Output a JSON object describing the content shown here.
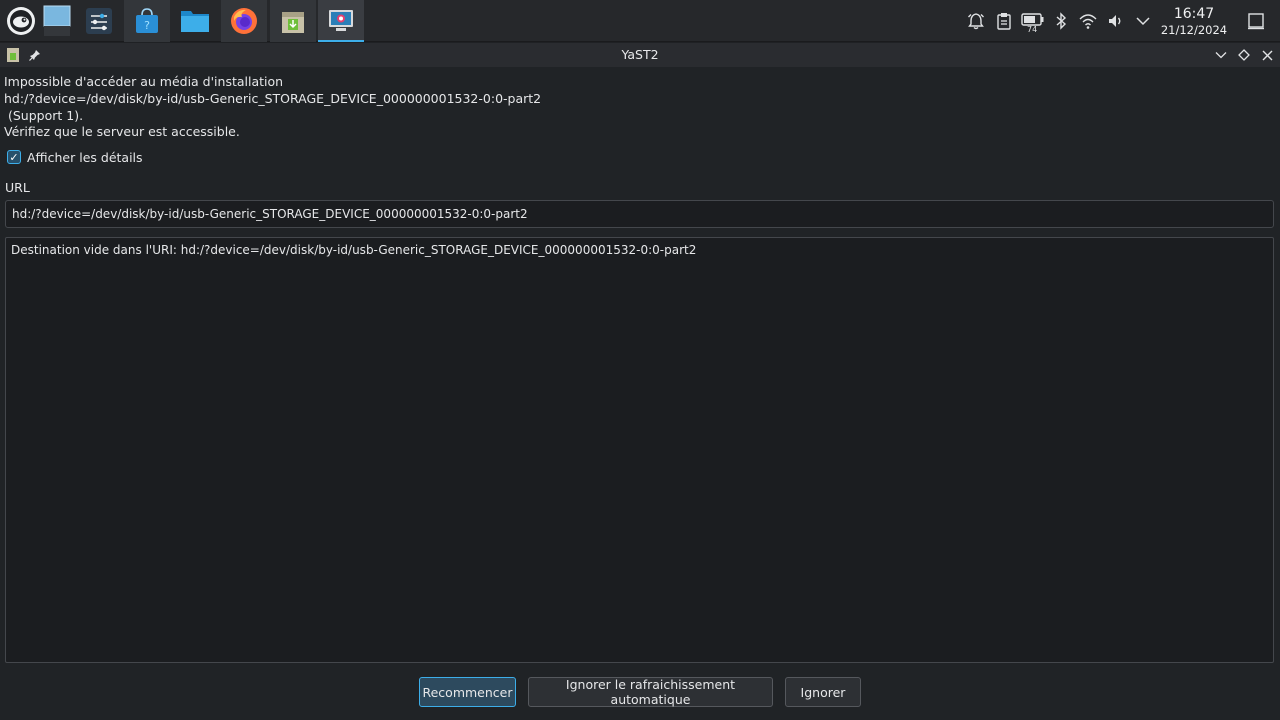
{
  "taskbar": {
    "apps": [
      {
        "name": "desktop",
        "icon": "desktop-icon"
      },
      {
        "name": "settings",
        "icon": "settings-icon"
      },
      {
        "name": "store",
        "icon": "store-icon"
      },
      {
        "name": "files",
        "icon": "folder-icon"
      },
      {
        "name": "firefox",
        "icon": "firefox-icon"
      },
      {
        "name": "package-installer",
        "icon": "package-icon"
      },
      {
        "name": "yast",
        "icon": "yast-icon"
      }
    ],
    "tray": {
      "battery_percent": "74",
      "time": "16:47",
      "date": "21/12/2024"
    }
  },
  "window": {
    "title": "YaST2"
  },
  "dialog": {
    "message": "Impossible d'accéder au média d'installation\nhd:/?device=/dev/disk/by-id/usb-Generic_STORAGE_DEVICE_000000001532-0:0-part2\n (Support 1).\nVérifiez que le serveur est accessible.",
    "show_details_label": "Afficher les détails",
    "show_details_checked": true,
    "url_label": "URL",
    "url_value": "hd:/?device=/dev/disk/by-id/usb-Generic_STORAGE_DEVICE_000000001532-0:0-part2",
    "details_text": "Destination vide dans l'URI: hd:/?device=/dev/disk/by-id/usb-Generic_STORAGE_DEVICE_000000001532-0:0-part2",
    "buttons": {
      "retry": "Recommencer",
      "ignore_autorefresh": "Ignorer le rafraichissement automatique",
      "ignore": "Ignorer"
    }
  },
  "colors": {
    "accent": "#3daee9",
    "panel_bg": "#26282b",
    "window_bg": "#202326"
  }
}
